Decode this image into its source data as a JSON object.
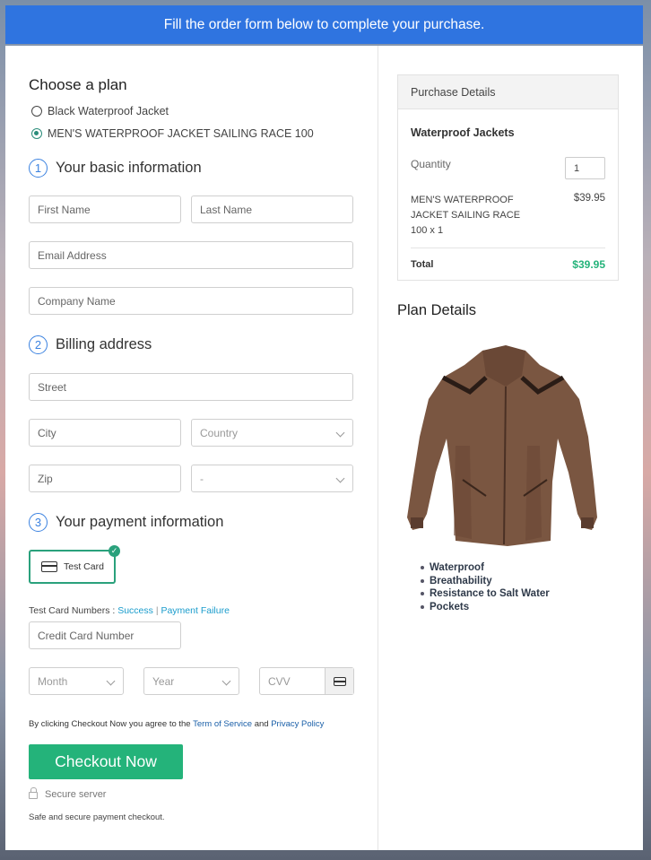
{
  "banner": "Fill the order form below to complete your purchase.",
  "plan": {
    "title": "Choose a plan",
    "options": [
      {
        "label": "Black Waterproof Jacket",
        "selected": false
      },
      {
        "label": "MEN'S WATERPROOF JACKET SAILING RACE 100",
        "selected": true
      }
    ]
  },
  "sections": {
    "basic": {
      "num": "1",
      "title": "Your basic information"
    },
    "billing": {
      "num": "2",
      "title": "Billing address"
    },
    "payment": {
      "num": "3",
      "title": "Your payment information"
    }
  },
  "fields": {
    "first_name": "First Name",
    "last_name": "Last Name",
    "email": "Email Address",
    "company": "Company Name",
    "street": "Street",
    "city": "City",
    "country": "Country",
    "zip": "Zip",
    "state": "-",
    "credit_card": "Credit Card Number",
    "month": "Month",
    "year": "Year",
    "cvv": "CVV"
  },
  "payment": {
    "test_card": "Test Card",
    "test_numbers_label": "Test Card Numbers :",
    "success": "Success",
    "separator": "|",
    "failure": "Payment Failure"
  },
  "terms": {
    "prefix": "By clicking Checkout Now you agree to the",
    "terms_link": "Term of Service",
    "and": "and",
    "privacy_link": "Privacy Policy"
  },
  "checkout_button": "Checkout Now",
  "secure_server": "Secure server",
  "safe_note": "Safe and secure payment checkout.",
  "purchase": {
    "header": "Purchase Details",
    "product_group": "Waterproof Jackets",
    "quantity_label": "Quantity",
    "quantity_value": "1",
    "item_line1": "MEN'S WATERPROOF",
    "item_line2": "JACKET SAILING RACE",
    "item_line3": "100 x 1",
    "item_price": "$39.95",
    "total_label": "Total",
    "total_value": "$39.95",
    "total_color": "#24b37a"
  },
  "plan_details": {
    "title": "Plan Details",
    "features": [
      "Waterproof",
      "Breathability",
      "Resistance to Salt Water",
      "Pockets"
    ]
  },
  "colors": {
    "banner": "#2f74e0",
    "accent_green": "#24b37a",
    "step_blue": "#3b82e0"
  }
}
